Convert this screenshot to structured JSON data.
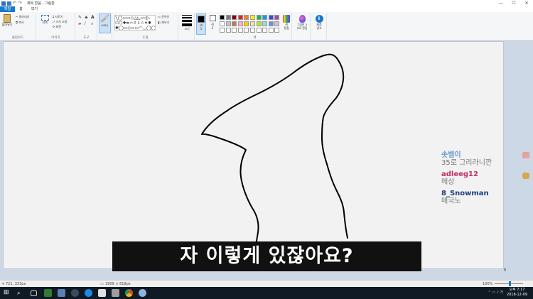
{
  "window": {
    "title": "제목 없음 - 그림판",
    "controls": [
      "—",
      "☐",
      "✕"
    ]
  },
  "tabs": [
    {
      "label": "파일",
      "active": true
    },
    {
      "label": "홈",
      "active": false
    },
    {
      "label": "보기",
      "active": false
    }
  ],
  "ribbon": {
    "clipboard": {
      "paste": "붙여넣기",
      "cut": "잘라내기",
      "copy": "복사",
      "label": "클립보드"
    },
    "image": {
      "select": "선택",
      "crop": "자르기",
      "resize": "크기 조정",
      "rotate": "회전",
      "label": "이미지"
    },
    "tools": {
      "label": "도구"
    },
    "brushes": {
      "label": "브러시"
    },
    "shapes": {
      "outline": "윤곽선",
      "fill": "채우기",
      "label": "도형",
      "grid": "╲◯▭▭◇△◺▱◁▷\n⬠⬡✚➨⇦⇧⇩☆✶✸\n✱◯▭◇▭▭◠◡◯◯"
    },
    "size": {
      "label": "크기"
    },
    "color1": {
      "label": "색\n1"
    },
    "color2": {
      "label": "색\n2"
    },
    "colors": {
      "label": "색"
    },
    "edit_colors": {
      "label": "색\n편집"
    },
    "paint3d": {
      "label": "그림판 3\nD로 편집"
    },
    "product_alert": {
      "label": "제품\n경고"
    }
  },
  "palette": {
    "row1": [
      "#000000",
      "#7f7f7f",
      "#880015",
      "#ed1c24",
      "#ff7f27",
      "#fff200",
      "#22b14c",
      "#00a2e8",
      "#3f48cc",
      "#a349a4"
    ],
    "row2": [
      "#ffffff",
      "#c3c3c3",
      "#b97a57",
      "#ffaec9",
      "#ffc90e",
      "#efe4b0",
      "#b5e61d",
      "#99d9ea",
      "#7092be",
      "#c8bfe7"
    ],
    "row3": [
      "#ffffff",
      "#ffffff",
      "#ffffff",
      "#ffffff",
      "#ffffff",
      "#ffffff",
      "#ffffff",
      "#ffffff",
      "#ffffff",
      "#ffffff"
    ],
    "color1": "#000000",
    "color2": "#ffffff"
  },
  "chat": [
    {
      "nick": "솟뱀이",
      "color": "#6a9fd4",
      "message": "35로 그리라니깐"
    },
    {
      "nick": "adleeg12",
      "color": "#c03060",
      "message": "메상"
    },
    {
      "nick": "8_Snowman",
      "color": "#1a3a7a",
      "message": "매국노"
    }
  ],
  "subtitle": "자 이렇게 있잖아요?",
  "status": {
    "cursor": "721, 333px",
    "canvas_size": "1909 × 818px",
    "zoom": "100%"
  },
  "taskbar": {
    "time": "오후 7:17",
    "date": "2018-12-09"
  }
}
